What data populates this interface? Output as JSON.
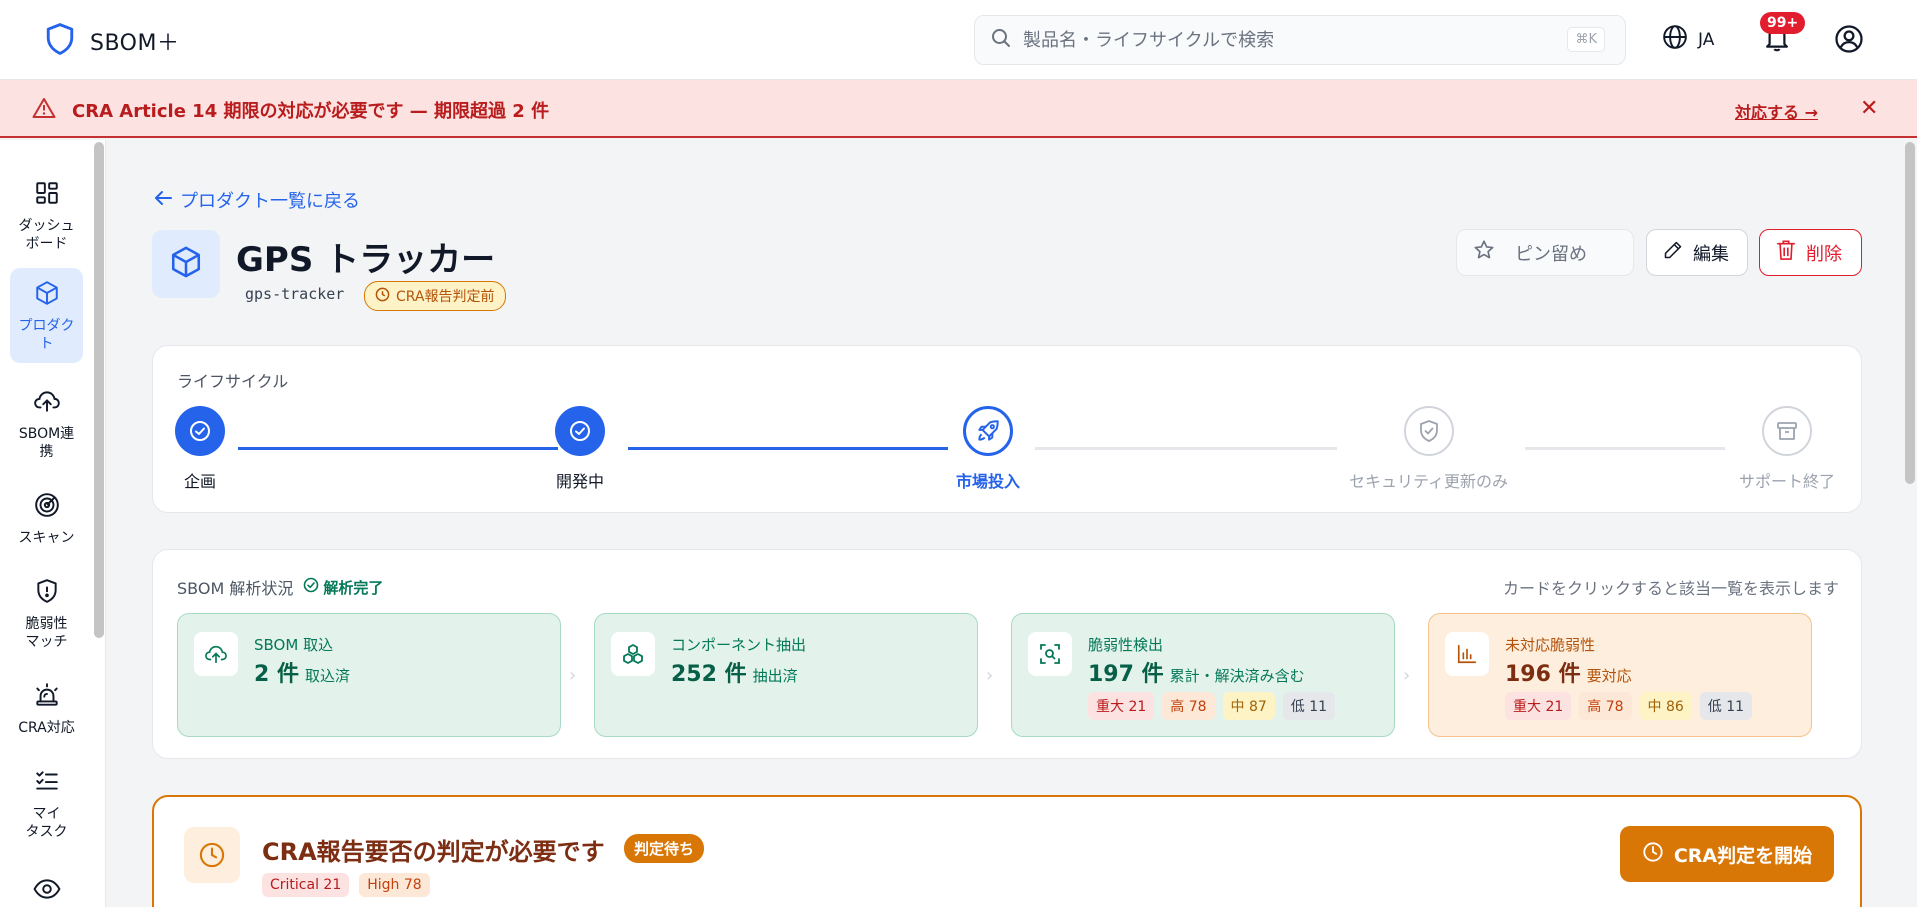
{
  "app": {
    "name": "SBOM＋"
  },
  "search": {
    "placeholder": "製品名・ライフサイクルで検索",
    "shortcut": "⌘K"
  },
  "header": {
    "language": "JA",
    "notification_count": "99+"
  },
  "alert": {
    "text": "CRA Article 14 期限の対応が必要です — 期限超過 2 件",
    "action": "対応する →",
    "close": "✕"
  },
  "sidebar": {
    "items": [
      {
        "label": "ダッシュ\nボード",
        "icon": "dashboard-icon"
      },
      {
        "label": "プロダク\nト",
        "icon": "box-icon",
        "active": true
      },
      {
        "label": "SBOM連\n携",
        "icon": "cloud-upload-icon"
      },
      {
        "label": "スキャン",
        "icon": "radar-icon"
      },
      {
        "label": "脆弱性\nマッチ",
        "icon": "shield-alert-icon"
      },
      {
        "label": "CRA対応",
        "icon": "siren-icon"
      },
      {
        "label": "マイ\nタスク",
        "icon": "checklist-icon"
      },
      {
        "label": "",
        "icon": "eye-icon"
      }
    ]
  },
  "product": {
    "back": "プロダクト一覧に戻る",
    "title": "GPS トラッカー",
    "slug": "gps-tracker",
    "status": "CRA報告判定前",
    "pin": "ピン留め",
    "edit": "編集",
    "delete": "削除"
  },
  "lifecycle": {
    "label": "ライフサイクル",
    "steps": [
      {
        "label": "企画",
        "state": "done"
      },
      {
        "label": "開発中",
        "state": "done"
      },
      {
        "label": "市場投入",
        "state": "current"
      },
      {
        "label": "セキュリティ更新のみ",
        "state": "future"
      },
      {
        "label": "サポート終了",
        "state": "future"
      }
    ]
  },
  "sbom": {
    "title": "SBOM 解析状況",
    "status": "解析完了",
    "hint": "カードをクリックすると該当一覧を表示します",
    "cards": [
      {
        "title": "SBOM 取込",
        "value": "2 件",
        "sub": "取込済"
      },
      {
        "title": "コンポーネント抽出",
        "value": "252 件",
        "sub": "抽出済"
      },
      {
        "title": "脆弱性検出",
        "value": "197 件",
        "sub": "累計・解決済み含む",
        "chips": [
          "重大 21",
          "高 78",
          "中 87",
          "低 11"
        ]
      },
      {
        "title": "未対応脆弱性",
        "value": "196 件",
        "sub": "要対応",
        "chips": [
          "重大 21",
          "高 78",
          "中 86",
          "低 11"
        ]
      }
    ]
  },
  "cra": {
    "title": "CRA報告要否の判定が必要です",
    "badge": "判定待ち",
    "chips": [
      "Critical 21",
      "High 78"
    ],
    "button": "CRA判定を開始"
  },
  "colors": {
    "accent": "#2563eb",
    "danger": "#e11d2e",
    "warning": "#d97706",
    "success": "#047857"
  }
}
